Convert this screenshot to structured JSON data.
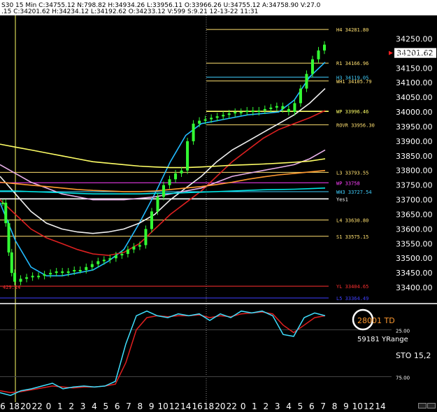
{
  "header": {
    "text": "S30  15 Min   C:34755.12  N:798.82  H:34934.26  L:33956.11  O:33966.26  U:34755.12  A:34758.90  V:27.0",
    "subtext": ".15  C:34201.62  H:34234.12  L:34192.62  O:34233.12  V:599  S:9.21  12-13-22  11:31"
  },
  "colors": {
    "background": "#000000",
    "price_up": "#33ff33",
    "ma_fast": "#22bbff",
    "ma_red": "#dd2020",
    "ma_white": "#f0f0f0",
    "ma_pink": "#e8b0e8",
    "ma_yellow": "#ffff66",
    "ma_orange": "#ff9a30",
    "cyan": "#00e5e5",
    "blue": "#2020ff",
    "magenta": "#ff40ff",
    "stoch_k": "#40e0ff",
    "stoch_d": "#e02020"
  },
  "chart_data": {
    "type": "line",
    "symbol": "S30",
    "interval": "15 Min",
    "ylim": [
      33350,
      34330
    ],
    "yticks": [
      34250.0,
      34200.0,
      34150.0,
      34100.0,
      34050.0,
      34000.0,
      33950.0,
      33900.0,
      33850.0,
      33800.0,
      33750.0,
      33700.0,
      33650.0,
      33600.0,
      33550.0,
      33500.0,
      33450.0,
      33400.0
    ],
    "last_price": "34201.62",
    "xtick_labels": [
      "6",
      "18",
      "20",
      "22",
      "0",
      "1",
      "2",
      "3",
      "4",
      "5",
      "6",
      "7",
      "8",
      "9",
      "10",
      "12",
      "14",
      "16",
      "18",
      "20",
      "22",
      "0",
      "1",
      "2",
      "3",
      "4",
      "5",
      "6",
      "7",
      "8",
      "9",
      "10",
      "12",
      "14"
    ],
    "price_series": [
      {
        "i": 0,
        "v": 33690
      },
      {
        "i": 1,
        "v": 33620
      },
      {
        "i": 2,
        "v": 33520
      },
      {
        "i": 3,
        "v": 33450
      },
      {
        "i": 4,
        "v": 33420
      },
      {
        "i": 6,
        "v": 33430
      },
      {
        "i": 8,
        "v": 33435
      },
      {
        "i": 10,
        "v": 33440
      },
      {
        "i": 12,
        "v": 33440
      },
      {
        "i": 14,
        "v": 33445
      },
      {
        "i": 16,
        "v": 33450
      },
      {
        "i": 18,
        "v": 33455
      },
      {
        "i": 20,
        "v": 33450
      },
      {
        "i": 22,
        "v": 33455
      },
      {
        "i": 24,
        "v": 33460
      },
      {
        "i": 26,
        "v": 33460
      },
      {
        "i": 28,
        "v": 33470
      },
      {
        "i": 30,
        "v": 33480
      },
      {
        "i": 32,
        "v": 33490
      },
      {
        "i": 34,
        "v": 33495
      },
      {
        "i": 36,
        "v": 33500
      },
      {
        "i": 38,
        "v": 33510
      },
      {
        "i": 40,
        "v": 33515
      },
      {
        "i": 42,
        "v": 33530
      },
      {
        "i": 44,
        "v": 33540
      },
      {
        "i": 46,
        "v": 33545
      },
      {
        "i": 48,
        "v": 33600
      },
      {
        "i": 50,
        "v": 33660
      },
      {
        "i": 52,
        "v": 33710
      },
      {
        "i": 54,
        "v": 33750
      },
      {
        "i": 56,
        "v": 33770
      },
      {
        "i": 58,
        "v": 33790
      },
      {
        "i": 60,
        "v": 33800
      },
      {
        "i": 62,
        "v": 33900
      },
      {
        "i": 64,
        "v": 33960
      },
      {
        "i": 66,
        "v": 33970
      },
      {
        "i": 68,
        "v": 33975
      },
      {
        "i": 70,
        "v": 33980
      },
      {
        "i": 72,
        "v": 33985
      },
      {
        "i": 74,
        "v": 33990
      },
      {
        "i": 76,
        "v": 33995
      },
      {
        "i": 78,
        "v": 34000
      },
      {
        "i": 80,
        "v": 34000
      },
      {
        "i": 82,
        "v": 34005
      },
      {
        "i": 84,
        "v": 34000
      },
      {
        "i": 86,
        "v": 34005
      },
      {
        "i": 88,
        "v": 34010
      },
      {
        "i": 90,
        "v": 34015
      },
      {
        "i": 92,
        "v": 34020
      },
      {
        "i": 94,
        "v": 34010
      },
      {
        "i": 96,
        "v": 34000
      },
      {
        "i": 98,
        "v": 34030
      },
      {
        "i": 100,
        "v": 34080
      },
      {
        "i": 102,
        "v": 34130
      },
      {
        "i": 104,
        "v": 34180
      },
      {
        "i": 106,
        "v": 34210
      },
      {
        "i": 108,
        "v": 34230
      }
    ],
    "moving_averages": [
      {
        "color_key": "ma_fast",
        "values": [
          33690,
          33560,
          33470,
          33440,
          33440,
          33450,
          33460,
          33490,
          33530,
          33620,
          33720,
          33830,
          33920,
          33960,
          33970,
          33980,
          33990,
          33995,
          34000,
          34040,
          34120,
          34170
        ]
      },
      {
        "color_key": "ma_red",
        "values": [
          33700,
          33650,
          33600,
          33570,
          33550,
          33530,
          33515,
          33510,
          33520,
          33550,
          33600,
          33650,
          33690,
          33730,
          33780,
          33830,
          33870,
          33910,
          33940,
          33960,
          33980,
          34005
        ]
      },
      {
        "color_key": "ma_white",
        "values": [
          33780,
          33720,
          33660,
          33620,
          33600,
          33590,
          33585,
          33590,
          33600,
          33620,
          33650,
          33700,
          33740,
          33780,
          33830,
          33870,
          33900,
          33930,
          33960,
          33990,
          34030,
          34080
        ]
      },
      {
        "color_key": "ma_pink",
        "values": [
          33820,
          33790,
          33760,
          33740,
          33720,
          33710,
          33700,
          33700,
          33700,
          33705,
          33710,
          33720,
          33730,
          33740,
          33760,
          33780,
          33790,
          33800,
          33810,
          33820,
          33840,
          33870
        ]
      },
      {
        "color_key": "ma_yellow",
        "values": [
          33890,
          33880,
          33870,
          33860,
          33850,
          33840,
          33830,
          33825,
          33820,
          33815,
          33812,
          33810,
          33810,
          33812,
          33815,
          33818,
          33820,
          33822,
          33825,
          33828,
          33832,
          33840
        ]
      },
      {
        "color_key": "ma_orange",
        "values": [
          33760,
          33755,
          33750,
          33745,
          33740,
          33735,
          33732,
          33730,
          33728,
          33728,
          33730,
          33735,
          33740,
          33745,
          33752,
          33760,
          33770,
          33778,
          33785,
          33790,
          33795,
          33800
        ]
      },
      {
        "color_key": "cyan",
        "values": [
          33730,
          33730,
          33728,
          33726,
          33724,
          33722,
          33720,
          33720,
          33720,
          33720,
          33722,
          33722,
          33724,
          33726,
          33728,
          33730,
          33732,
          33734,
          33735,
          33736,
          33738,
          33740
        ]
      }
    ],
    "levels": [
      {
        "label": "H4  34281.80",
        "value": 34281.8,
        "color": "#ffe070"
      },
      {
        "label": "R1  34166.96",
        "value": 34166.96,
        "color": "#ffe070"
      },
      {
        "label": "H3  34119.05",
        "value": 34119.05,
        "color": "#40d0ff"
      },
      {
        "label": "WH1  34105.79",
        "value": 34105.79,
        "color": "#ffe070"
      },
      {
        "label": "WP  33996.46",
        "value": 34002.0,
        "color": "#ffff66"
      },
      {
        "label": "ROVR  33956.30",
        "value": 33956.3,
        "color": "#ffe070"
      },
      {
        "label": "L3  33793.55",
        "value": 33793.55,
        "color": "#ffe070"
      },
      {
        "label": "WP  33758",
        "value": 33758,
        "color": "#ff40ff"
      },
      {
        "label": "WH3  33727.54",
        "value": 33727.54,
        "color": "#40d0ff"
      },
      {
        "label": "Yes1",
        "value": 33703,
        "color": "#ffffff"
      },
      {
        "label": "L4  33630.80",
        "value": 33630.8,
        "color": "#ffe070"
      },
      {
        "label": "S1  33575.15",
        "value": 33575.15,
        "color": "#ffe070"
      },
      {
        "label": "YL  33404.65",
        "value": 33404.65,
        "color": "#ff3030"
      },
      {
        "label": "L5  33364.49",
        "value": 33364.49,
        "color": "#4040ff"
      }
    ],
    "left_label": "429.14",
    "stochastic": {
      "name": "STO  15,2",
      "ticks": [
        "25.00",
        "75.00"
      ],
      "k": [
        8,
        5,
        10,
        12,
        15,
        18,
        12,
        14,
        15,
        14,
        15,
        20,
        60,
        90,
        95,
        90,
        88,
        92,
        90,
        92,
        85,
        92,
        88,
        95,
        93,
        95,
        90,
        70,
        68,
        88,
        93,
        90
      ],
      "d": [
        10,
        8,
        9,
        11,
        13,
        15,
        14,
        13,
        14,
        14,
        15,
        17,
        40,
        75,
        88,
        90,
        89,
        90,
        90,
        91,
        88,
        90,
        89,
        92,
        93,
        94,
        92,
        80,
        72,
        80,
        88,
        90
      ],
      "td_value": "28001 TD",
      "yrange": "59181 YRange"
    }
  }
}
